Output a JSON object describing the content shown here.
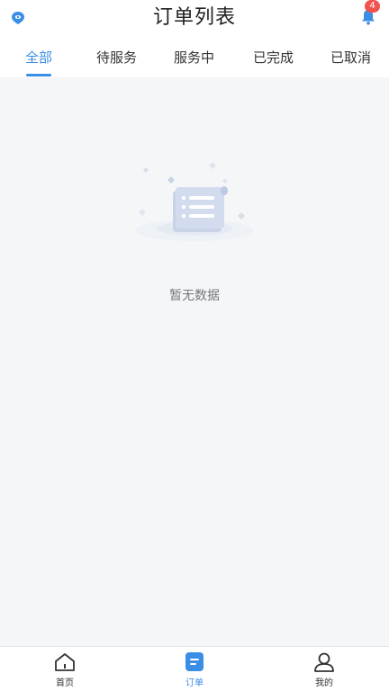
{
  "header": {
    "title": "订单列表",
    "notification_count": "4"
  },
  "tabs": [
    {
      "label": "全部",
      "active": true
    },
    {
      "label": "待服务",
      "active": false
    },
    {
      "label": "服务中",
      "active": false
    },
    {
      "label": "已完成",
      "active": false
    },
    {
      "label": "已取消",
      "active": false
    }
  ],
  "empty_state": {
    "text": "暂无数据",
    "icon": "empty-list-illustration"
  },
  "bottom_nav": [
    {
      "label": "首页",
      "icon": "home-icon",
      "active": false
    },
    {
      "label": "订单",
      "icon": "order-icon",
      "active": true
    },
    {
      "label": "我的",
      "icon": "user-icon",
      "active": false
    }
  ],
  "colors": {
    "accent": "#3a8ee6",
    "badge": "#f0524f",
    "background": "#f5f6f8"
  }
}
